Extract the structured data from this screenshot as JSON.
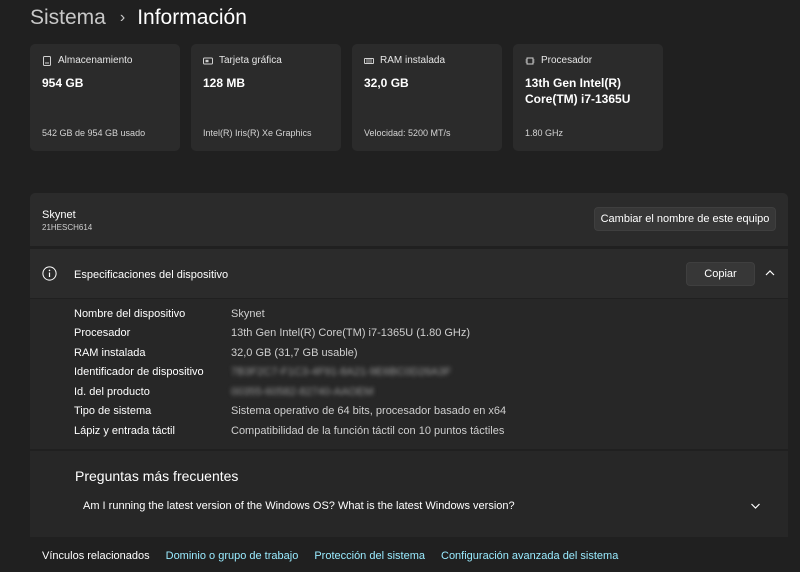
{
  "breadcrumb": {
    "parent": "Sistema",
    "separator": "›",
    "current": "Información"
  },
  "cards": [
    {
      "label": "Almacenamiento",
      "value": "954 GB",
      "sub": "542 GB de 954 GB usado",
      "icon": "storage-icon"
    },
    {
      "label": "Tarjeta gráfica",
      "value": "128 MB",
      "sub": "Intel(R) Iris(R) Xe Graphics",
      "icon": "gpu-icon"
    },
    {
      "label": "RAM instalada",
      "value": "32,0 GB",
      "sub": "Velocidad: 5200 MT/s",
      "icon": "ram-icon"
    },
    {
      "label": "Procesador",
      "value_line1": "13th Gen Intel(R)",
      "value_line2": "Core(TM) i7-1365U",
      "sub": "1.80 GHz",
      "icon": "processor-icon"
    }
  ],
  "device": {
    "name": "Skynet",
    "model": "21HESCH614",
    "rename_button": "Cambiar el nombre de este equipo"
  },
  "specs": {
    "title": "Especificaciones del dispositivo",
    "copy_button": "Copiar",
    "rows": [
      {
        "key": "Nombre del dispositivo",
        "value": "Skynet"
      },
      {
        "key": "Procesador",
        "value": "13th Gen Intel(R) Core(TM) i7-1365U (1.80 GHz)"
      },
      {
        "key": "RAM instalada",
        "value": "32,0 GB (31,7 GB usable)"
      },
      {
        "key": "Identificador de dispositivo",
        "value": "7B3F2C7-F1C3-4F91-8A21-9E6BC0D26A3F",
        "blurred": true
      },
      {
        "key": "Id. del producto",
        "value": "00355-60582-82740-AAOEM",
        "blurred": true
      },
      {
        "key": "Tipo de sistema",
        "value": "Sistema operativo de 64 bits, procesador basado en x64"
      },
      {
        "key": "Lápiz y entrada táctil",
        "value": "Compatibilidad de la función táctil con 10 puntos táctiles"
      }
    ]
  },
  "faq": {
    "title": "Preguntas más frecuentes",
    "question": "Am I running the latest version of the Windows OS? What is the latest Windows version?"
  },
  "related": {
    "label": "Vínculos relacionados",
    "links": [
      "Dominio o grupo de trabajo",
      "Protección del sistema",
      "Configuración avanzada del sistema"
    ]
  },
  "colors": {
    "background": "#202020",
    "card": "#2b2b2b",
    "link": "#99ebff"
  }
}
